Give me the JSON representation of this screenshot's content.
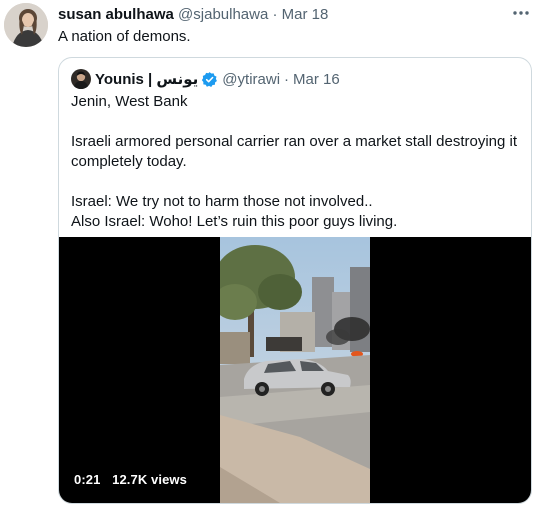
{
  "tweet": {
    "author_name": "susan abulhawa",
    "handle": "@sjabulhawa",
    "separator": "·",
    "date": "Mar 18",
    "text": "A nation of demons.",
    "more_icon": "more-icon"
  },
  "quoted": {
    "author_name": "Younis | يونس",
    "handle": "@ytirawi",
    "separator": "·",
    "date": "Mar 16",
    "verified_color": "#1d9bf0",
    "lines": [
      "Jenin, West Bank",
      "Israeli armored personal carrier ran over a market stall destroying it completely  today.",
      "Israel: We try not to harm those not involved..",
      "Also Israel: Woho! Let’s ruin this poor guys living."
    ],
    "video": {
      "duration": "0:21",
      "views": "12.7K views"
    }
  }
}
